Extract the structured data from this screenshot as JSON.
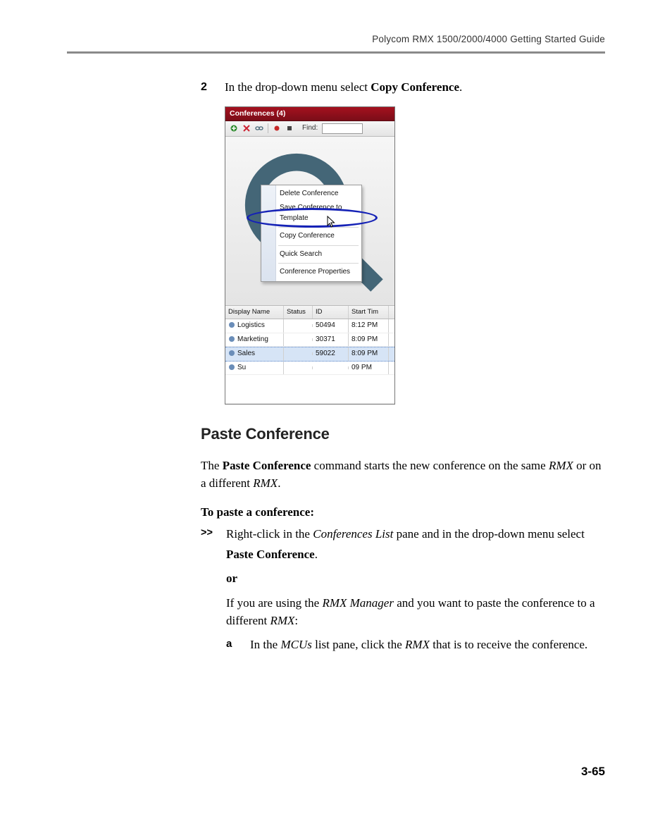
{
  "header": {
    "running": "Polycom RMX 1500/2000/4000 Getting Started Guide"
  },
  "step2": {
    "number": "2",
    "pre": "In the drop-down menu select ",
    "bold": "Copy Conference",
    "post": "."
  },
  "uiShot": {
    "title": "Conferences (4)",
    "findLabel": "Find:",
    "headers": {
      "name": "Display Name",
      "status": "Status",
      "id": "ID",
      "time": "Start Tim"
    },
    "rows": [
      {
        "name": "Logistics",
        "id": "50494",
        "time": "8:12 PM"
      },
      {
        "name": "Marketing",
        "id": "30371",
        "time": "8:09 PM"
      },
      {
        "name": "Sales",
        "id": "59022",
        "time": "8:09 PM"
      },
      {
        "name": "Su",
        "id": "",
        "time": "09 PM"
      }
    ],
    "menu": {
      "items": [
        "Delete Conference",
        "Save Conference to Template",
        "Copy Conference",
        "Quick Search",
        "Conference Properties"
      ]
    }
  },
  "section": {
    "title": "Paste Conference"
  },
  "intro": {
    "t1": "The ",
    "b1": "Paste Conference",
    "t2": " command starts the new conference on the same ",
    "i1": "RMX",
    "t3": " or on a different ",
    "i2": "RMX",
    "t4": "."
  },
  "proc": {
    "head": "To paste a conference:",
    "bullet": ">>",
    "s1a": "Right-click in the ",
    "s1i": "Conferences List",
    "s1b": " pane and in the drop-down menu select",
    "s1bold": "Paste Conference",
    "s1end": ".",
    "or": "or",
    "s2a": "If you are using the ",
    "s2i": "RMX Manager",
    "s2b": " and you want to paste the conference to a different ",
    "s2i2": "RMX",
    "s2c": ":",
    "sub": {
      "letter": "a",
      "a": "In the ",
      "i1": "MCUs",
      "b": " list pane, click the ",
      "i2": "RMX",
      "c": " that is to receive the conference."
    }
  },
  "pageNumber": "3-65"
}
